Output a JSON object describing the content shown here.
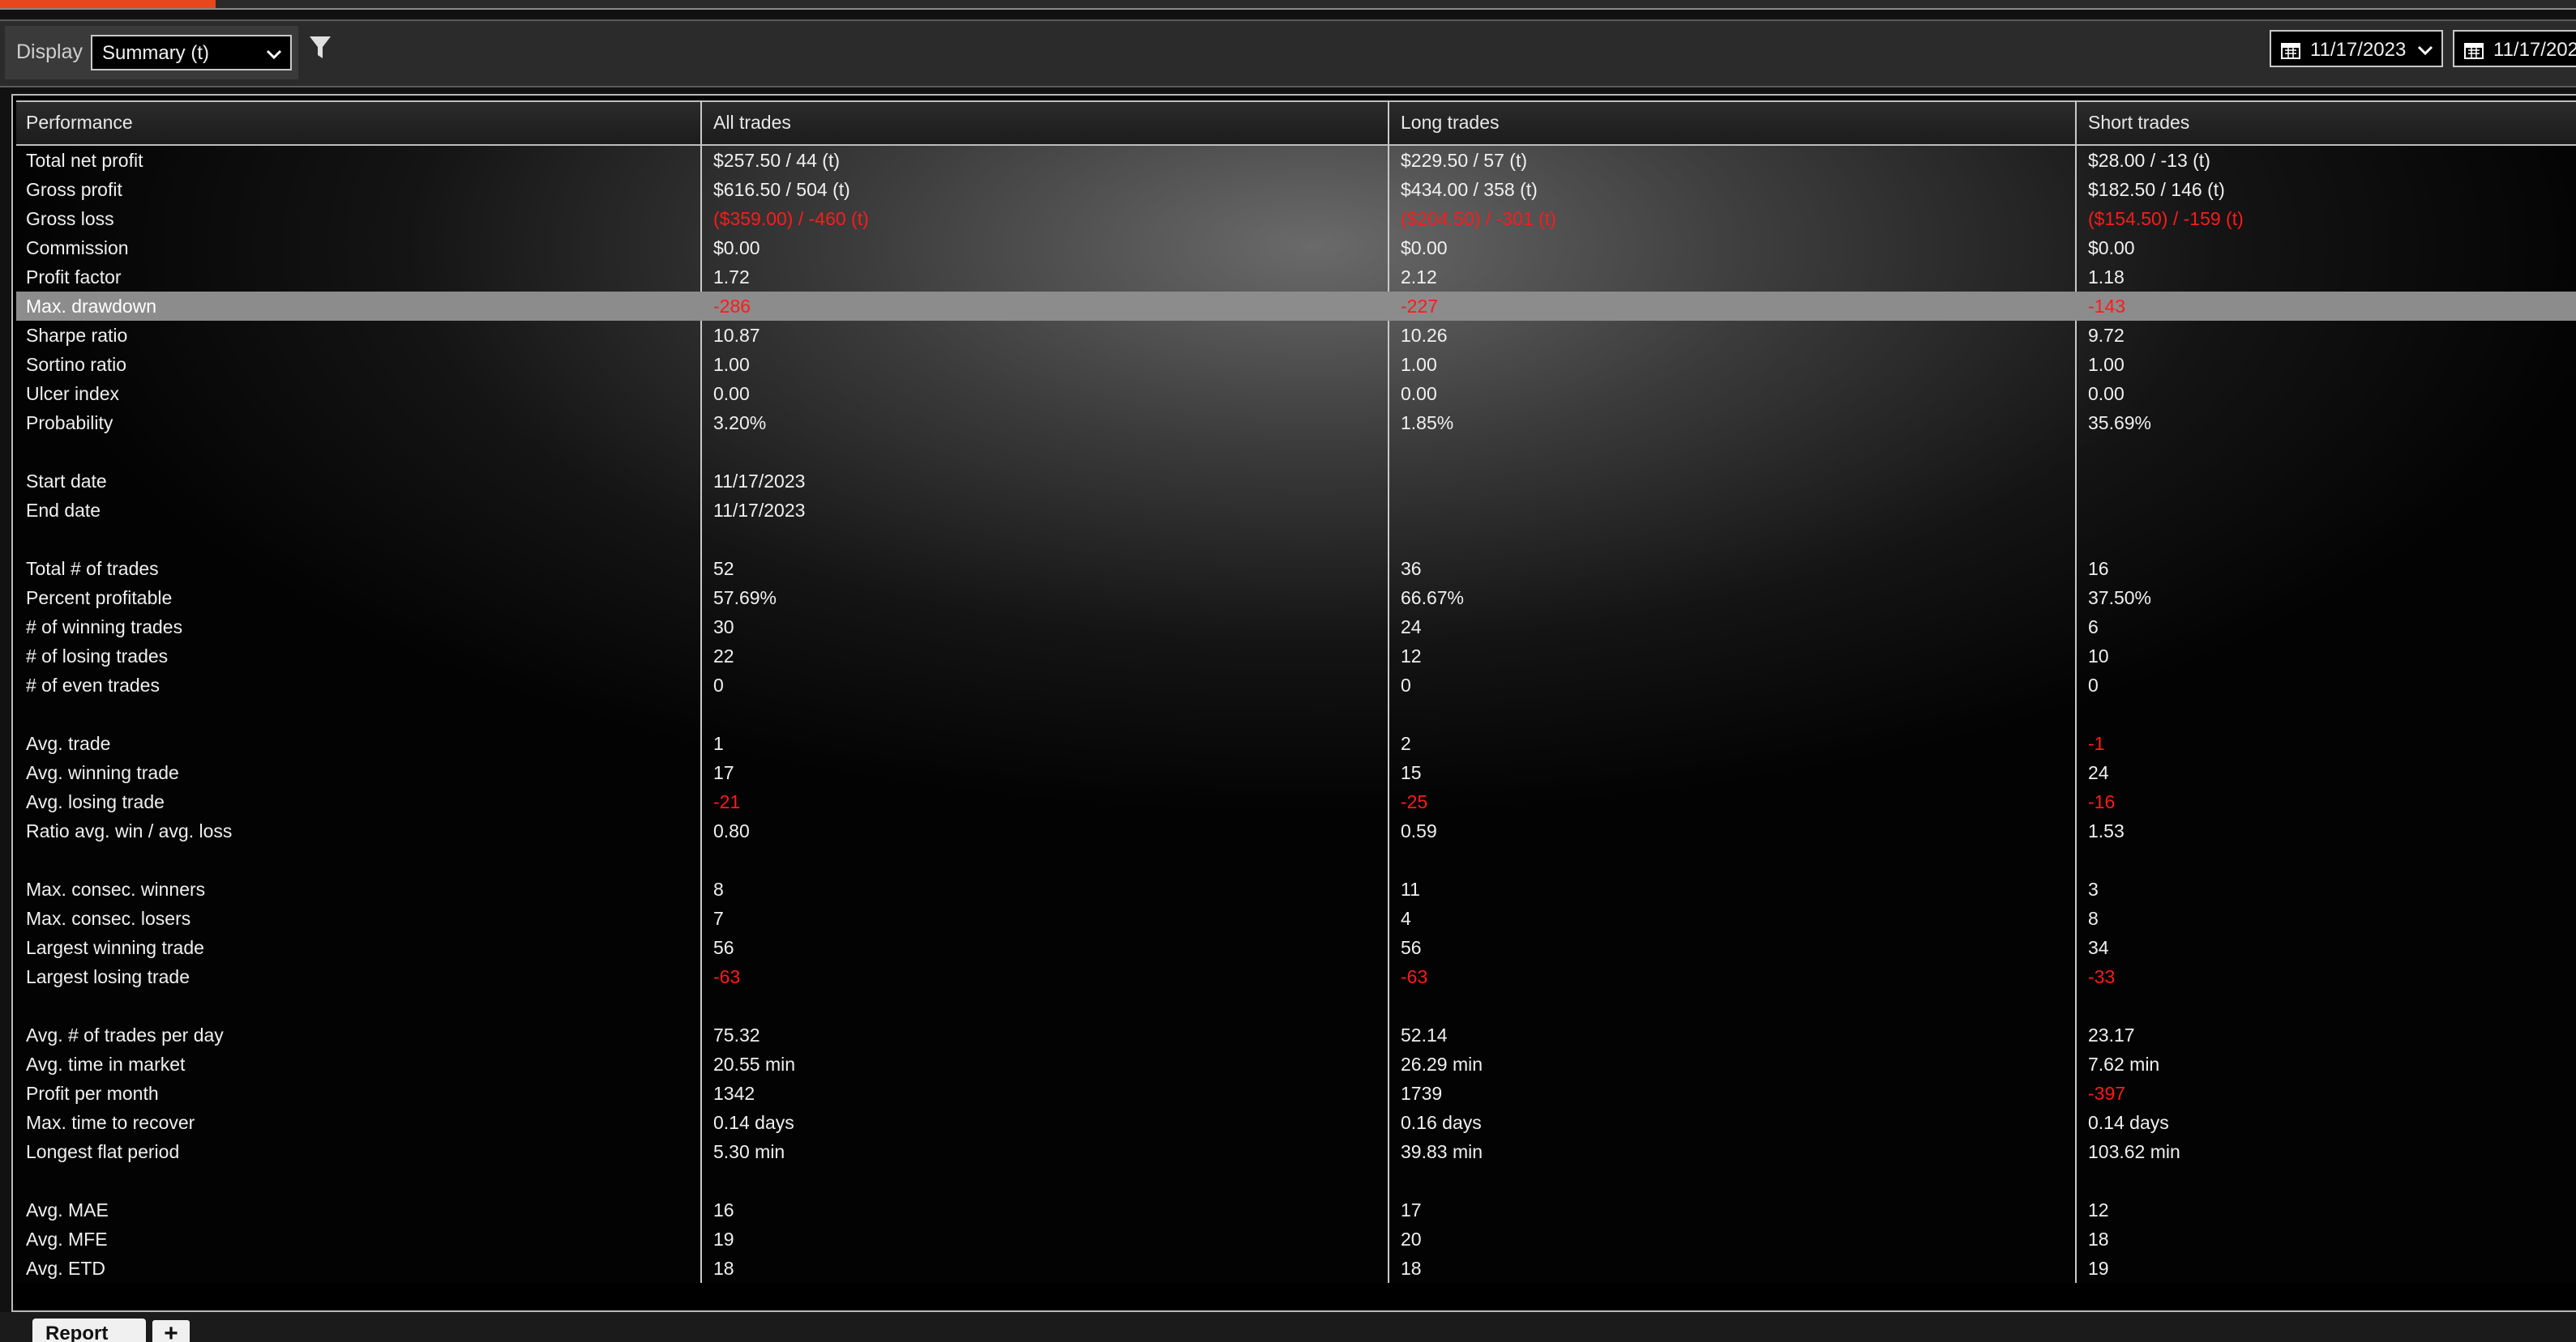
{
  "toolbar": {
    "display_label": "Display",
    "display_value": "Summary (t)",
    "date_from": "11/17/2023",
    "date_to": "11/17/2023"
  },
  "table": {
    "columns": [
      "Performance",
      "All trades",
      "Long trades",
      "Short trades"
    ],
    "selected_row": "Max. drawdown",
    "rows": [
      {
        "label": "Total net profit",
        "all": "$257.50 / 44 (t)",
        "long": "$229.50 / 57 (t)",
        "short": "$28.00 / -13 (t)"
      },
      {
        "label": "Gross profit",
        "all": "$616.50 / 504 (t)",
        "long": "$434.00 / 358 (t)",
        "short": "$182.50 / 146 (t)"
      },
      {
        "label": "Gross loss",
        "all": "($359.00) / -460 (t)",
        "long": "($204.50) / -301 (t)",
        "short": "($154.50) / -159 (t)"
      },
      {
        "label": "Commission",
        "all": "$0.00",
        "long": "$0.00",
        "short": "$0.00"
      },
      {
        "label": "Profit factor",
        "all": "1.72",
        "long": "2.12",
        "short": "1.18"
      },
      {
        "label": "Max. drawdown",
        "all": "-286",
        "long": "-227",
        "short": "-143"
      },
      {
        "label": "Sharpe ratio",
        "all": "10.87",
        "long": "10.26",
        "short": "9.72"
      },
      {
        "label": "Sortino ratio",
        "all": "1.00",
        "long": "1.00",
        "short": "1.00"
      },
      {
        "label": "Ulcer index",
        "all": "0.00",
        "long": "0.00",
        "short": "0.00"
      },
      {
        "label": "Probability",
        "all": "3.20%",
        "long": "1.85%",
        "short": "35.69%"
      },
      {
        "label": "",
        "all": "",
        "long": "",
        "short": ""
      },
      {
        "label": "Start date",
        "all": "11/17/2023",
        "long": "",
        "short": ""
      },
      {
        "label": "End date",
        "all": "11/17/2023",
        "long": "",
        "short": ""
      },
      {
        "label": "",
        "all": "",
        "long": "",
        "short": ""
      },
      {
        "label": "Total # of trades",
        "all": "52",
        "long": "36",
        "short": "16"
      },
      {
        "label": "Percent profitable",
        "all": "57.69%",
        "long": "66.67%",
        "short": "37.50%"
      },
      {
        "label": "# of winning trades",
        "all": "30",
        "long": "24",
        "short": "6"
      },
      {
        "label": "# of losing trades",
        "all": "22",
        "long": "12",
        "short": "10"
      },
      {
        "label": "# of even trades",
        "all": "0",
        "long": "0",
        "short": "0"
      },
      {
        "label": "",
        "all": "",
        "long": "",
        "short": ""
      },
      {
        "label": "Avg. trade",
        "all": "1",
        "long": "2",
        "short": "-1"
      },
      {
        "label": "Avg. winning trade",
        "all": "17",
        "long": "15",
        "short": "24"
      },
      {
        "label": "Avg. losing trade",
        "all": "-21",
        "long": "-25",
        "short": "-16"
      },
      {
        "label": "Ratio avg. win / avg. loss",
        "all": "0.80",
        "long": "0.59",
        "short": "1.53"
      },
      {
        "label": "",
        "all": "",
        "long": "",
        "short": ""
      },
      {
        "label": "Max. consec. winners",
        "all": "8",
        "long": "11",
        "short": "3"
      },
      {
        "label": "Max. consec. losers",
        "all": "7",
        "long": "4",
        "short": "8"
      },
      {
        "label": "Largest winning trade",
        "all": "56",
        "long": "56",
        "short": "34"
      },
      {
        "label": "Largest losing trade",
        "all": "-63",
        "long": "-63",
        "short": "-33"
      },
      {
        "label": "",
        "all": "",
        "long": "",
        "short": ""
      },
      {
        "label": "Avg. # of trades per day",
        "all": "75.32",
        "long": "52.14",
        "short": "23.17"
      },
      {
        "label": "Avg. time in market",
        "all": "20.55 min",
        "long": "26.29 min",
        "short": "7.62 min"
      },
      {
        "label": "Profit per month",
        "all": "1342",
        "long": "1739",
        "short": "-397"
      },
      {
        "label": "Max. time to recover",
        "all": "0.14 days",
        "long": "0.16 days",
        "short": "0.14 days"
      },
      {
        "label": "Longest flat period",
        "all": "5.30 min",
        "long": "39.83 min",
        "short": "103.62 min"
      },
      {
        "label": "",
        "all": "",
        "long": "",
        "short": ""
      },
      {
        "label": "Avg. MAE",
        "all": "16",
        "long": "17",
        "short": "12"
      },
      {
        "label": "Avg. MFE",
        "all": "19",
        "long": "20",
        "short": "18"
      },
      {
        "label": "Avg. ETD",
        "all": "18",
        "long": "18",
        "short": "19"
      }
    ]
  },
  "tabs": {
    "report_label": "Report",
    "add_label": "+"
  },
  "colors": {
    "accent": "#e8461c",
    "negative": "#ff1a1a",
    "selected_row": "#8c8c8c"
  },
  "icons": {
    "filter": "filter-icon",
    "calendar": "calendar-icon",
    "dropdown": "chevron-down-icon"
  }
}
